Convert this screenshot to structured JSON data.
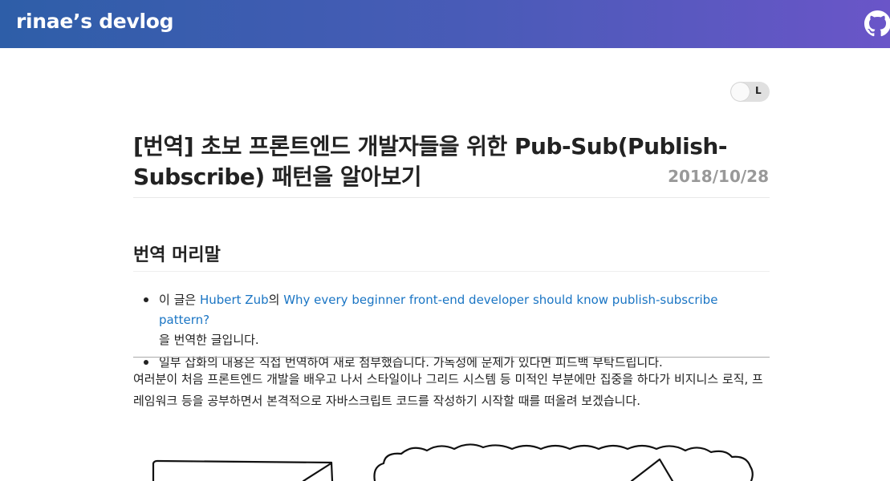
{
  "header": {
    "site_title": "rinae’s devlog",
    "github_icon": "github-icon"
  },
  "theme_toggle": {
    "label": "L"
  },
  "post": {
    "title": "[번역] 초보 프론트엔드 개발자들을 위한 Pub-Sub(Publish-Subscribe) 패턴을 알아보기",
    "date": "2018/10/28"
  },
  "section": {
    "title": "번역 머리말"
  },
  "notes": {
    "item1": {
      "prefix": "이 글은 ",
      "author_link": "Hubert Zub",
      "middle": "의 ",
      "article_link": "Why every beginner front-end developer should know publish-subscribe pattern?",
      "suffix": "을 번역한 글입니다."
    },
    "item2": "일부 삽화의 내용은 직접 번역하여 새로 첨부했습니다. 가독성에 문제가 있다면 피드백 부탁드립니다."
  },
  "body": {
    "paragraph1": "여러분이 처음 프론트엔드 개발을 배우고 나서 스타일이나 그리드 시스템 등 미적인 부분에만 집중을 하다가 비지니스 로직, 프레임워크 등을 공부하면서 본격적으로 자바스크립트 코드를 작성하기 시작할 때를 떠올려 보겠습니다."
  },
  "colors": {
    "header_gradient_start": "#2e5ea8",
    "header_gradient_end": "#6a55c8",
    "link": "#1a75c4",
    "date": "#999999"
  }
}
